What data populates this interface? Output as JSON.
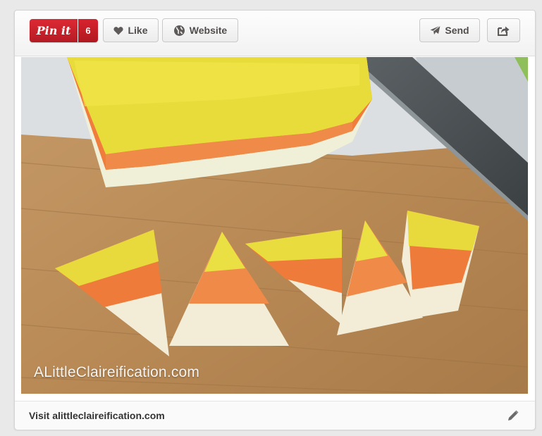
{
  "toolbar": {
    "pin_it_label": "Pin it",
    "pin_count": "6",
    "like_label": "Like",
    "website_label": "Website",
    "send_label": "Send"
  },
  "icons": {
    "like": "heart-icon",
    "website": "globe-icon",
    "send": "paper-plane-icon",
    "share": "share-icon",
    "edit": "pencil-icon"
  },
  "image": {
    "watermark": "ALittleClaireification.com"
  },
  "footer": {
    "link_text": "Visit alittleclaireification.com"
  },
  "colors": {
    "pinterest_red": "#cb2027",
    "button_text": "#524d4d"
  }
}
